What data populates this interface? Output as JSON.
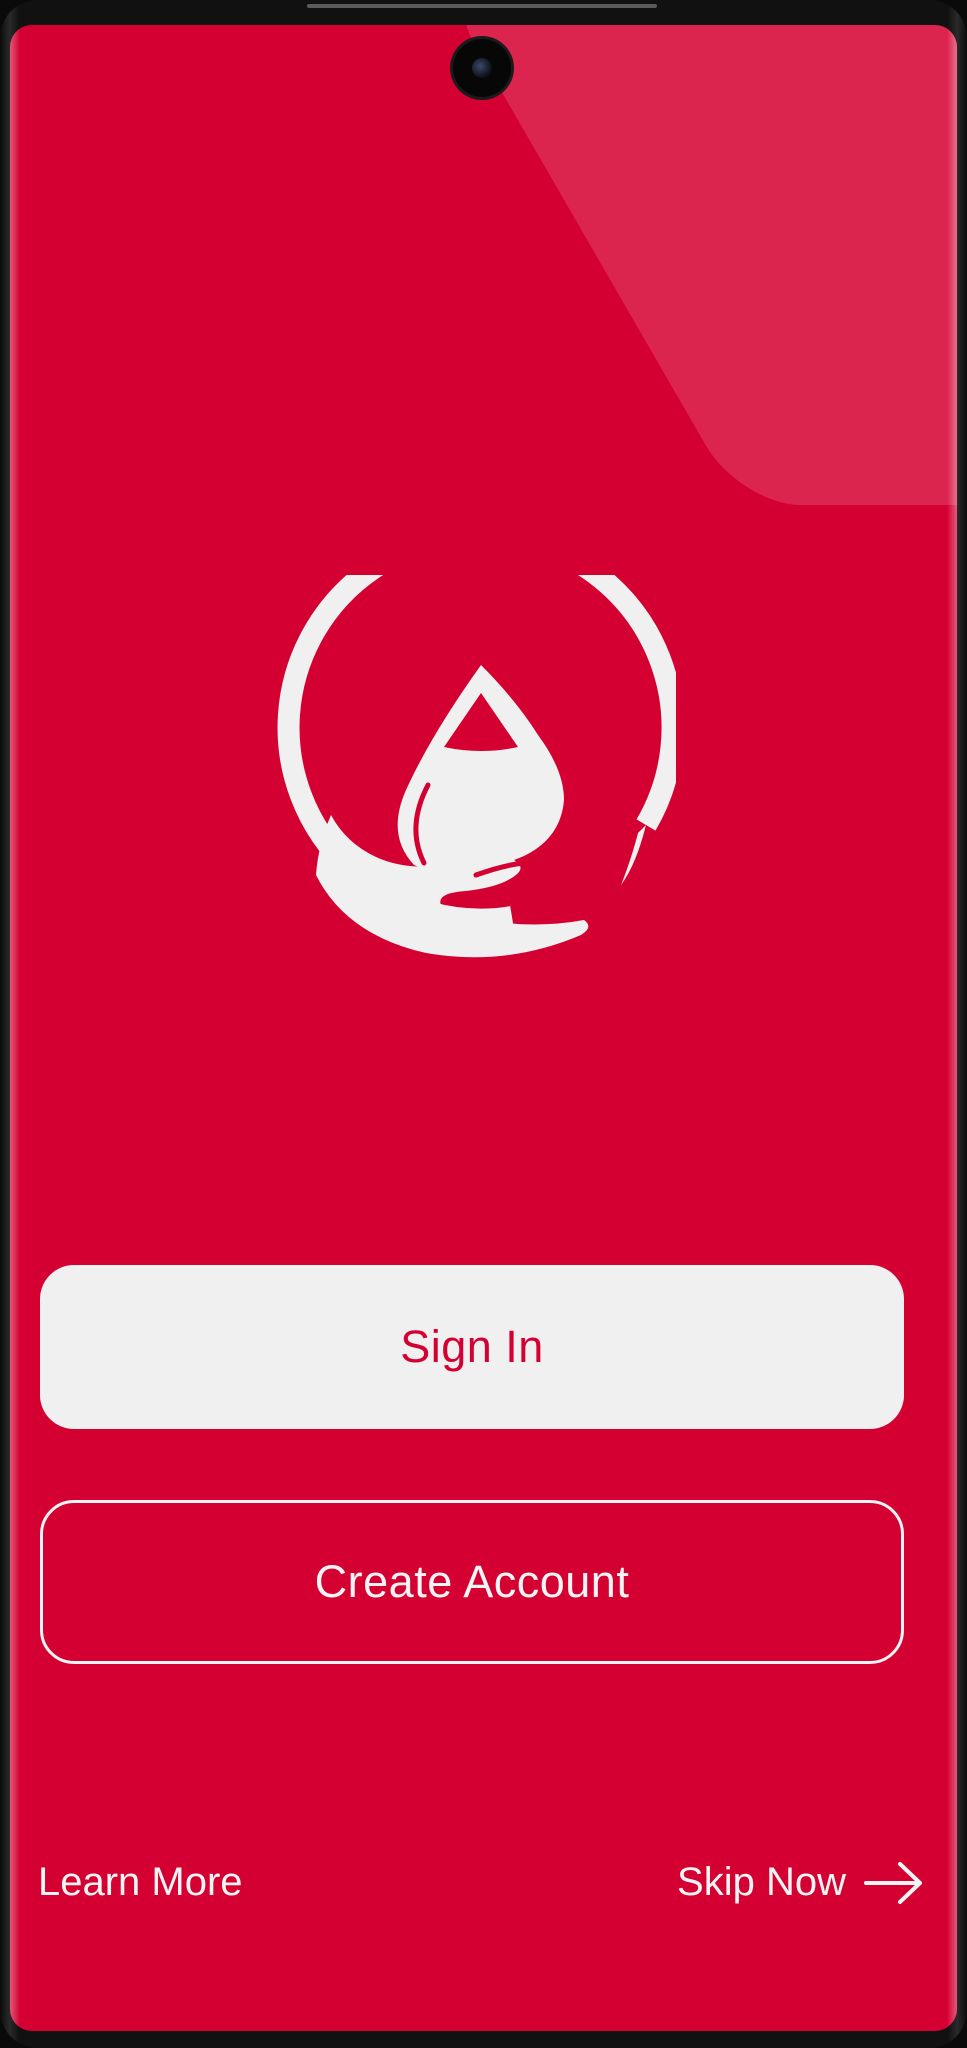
{
  "colors": {
    "brand": "#D50032",
    "button_fill": "#F0F0F0",
    "on_brand": "#F4F4F4"
  },
  "logo": {
    "icon": "blood-drop-hand-icon"
  },
  "actions": {
    "sign_in_label": "Sign In",
    "create_account_label": "Create Account"
  },
  "footer": {
    "learn_more_label": "Learn More",
    "skip_now_label": "Skip Now",
    "skip_icon": "arrow-right-icon"
  }
}
